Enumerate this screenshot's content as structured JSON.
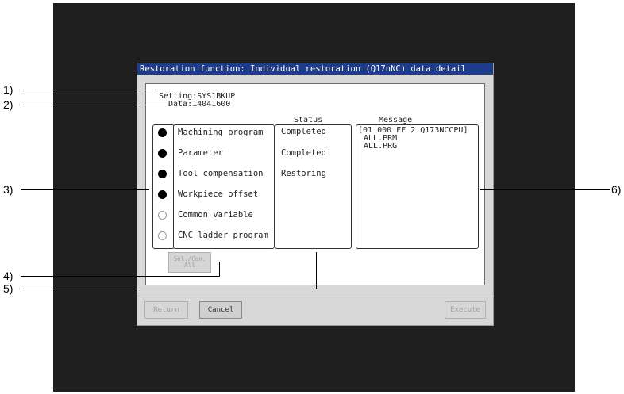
{
  "dialog": {
    "title": "Restoration function: Individual restoration (Q17nNC) data detail"
  },
  "setting": {
    "setting_line": "Setting:SYS1BKUP",
    "data_line": "Data:14041600"
  },
  "columns": {
    "status_header": "Status",
    "message_header": "Message"
  },
  "items": [
    {
      "label": "Machining program",
      "selected": true,
      "status": "Completed"
    },
    {
      "label": "Parameter",
      "selected": true,
      "status": "Completed"
    },
    {
      "label": "Tool compensation",
      "selected": true,
      "status": "Restoring"
    },
    {
      "label": "Workpiece offset",
      "selected": true,
      "status": ""
    },
    {
      "label": "Common variable",
      "selected": false,
      "status": ""
    },
    {
      "label": "CNC ladder program",
      "selected": false,
      "status": ""
    }
  ],
  "messages": [
    "[01 000 FF 2 Q173NCCPU]",
    "ALL.PRM",
    "ALL.PRG"
  ],
  "buttons": {
    "sel_can_all_line1": "Sel./Can.",
    "sel_can_all_line2": "All",
    "return": "Return",
    "cancel": "Cancel",
    "execute": "Execute"
  },
  "callouts": {
    "c1": "1)",
    "c2": "2)",
    "c3": "3)",
    "c4": "4)",
    "c5": "5)",
    "c6": "6)"
  },
  "colors": {
    "titlebar": "#1e3c8c",
    "screen_bg": "#1f1f1f",
    "dialog_bg": "#d8d8d8"
  }
}
